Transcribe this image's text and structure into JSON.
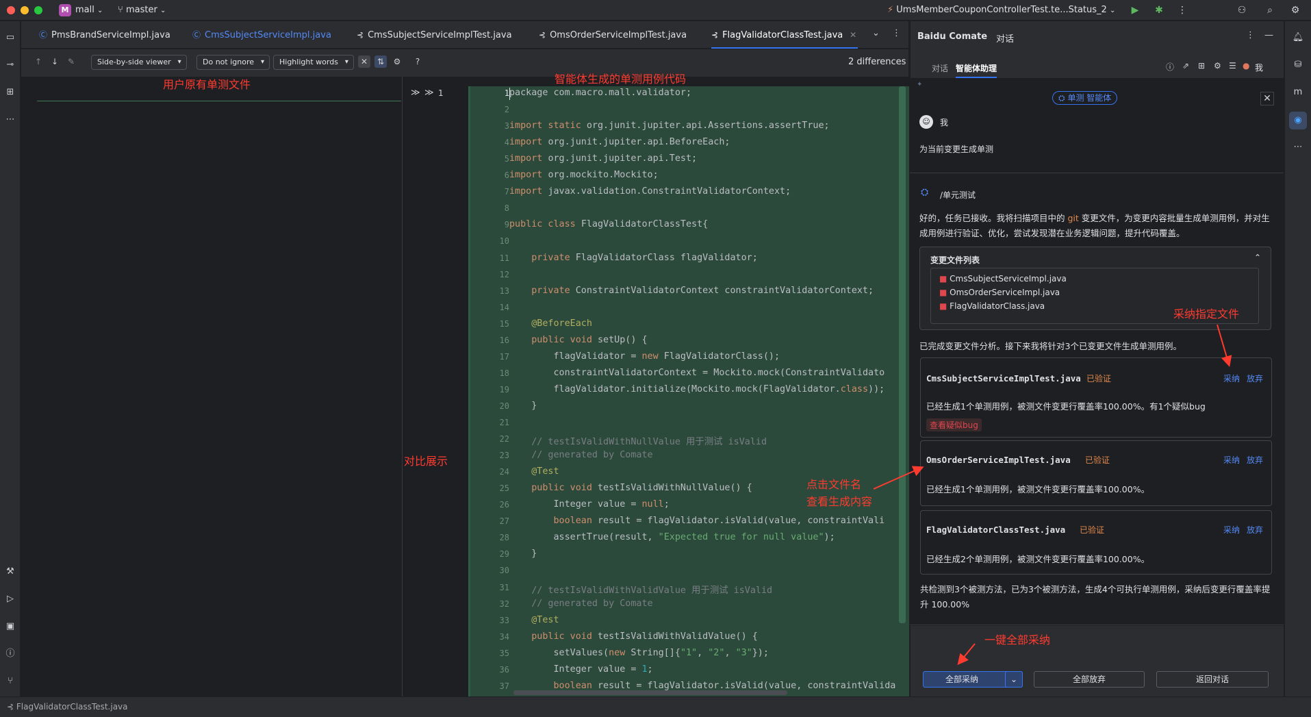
{
  "titlebar": {
    "project_badge": "M",
    "project_name": "mall",
    "branch": "master",
    "run_config": "UmsMemberCouponControllerTest.te...Status_2"
  },
  "tabs": [
    {
      "label": "PmsBrandServiceImpl.java"
    },
    {
      "label": "CmsSubjectServiceImpl.java"
    },
    {
      "label": "CmsSubjectServiceImplTest.java"
    },
    {
      "label": "OmsOrderServiceImplTest.java"
    },
    {
      "label": "FlagValidatorClassTest.java"
    }
  ],
  "diff_toolbar": {
    "viewer": "Side-by-side viewer",
    "ignore": "Do not ignore",
    "highlight": "Highlight words",
    "help": "?",
    "differences": "2 differences"
  },
  "gutter": {
    "line_counter": "1"
  },
  "annotations": {
    "left_pane": "用户原有单测文件",
    "code_pane": "智能体生成的单测用例代码",
    "compare": "对比展示",
    "click_file_1": "点击文件名",
    "click_file_2": "查看生成内容",
    "adopt_file": "采纳指定文件",
    "adopt_all": "一键全部采纳"
  },
  "code_lines": [
    {
      "n": "1"
    },
    {
      "n": "2"
    },
    {
      "n": "3"
    },
    {
      "n": "4"
    },
    {
      "n": "5"
    },
    {
      "n": "6"
    },
    {
      "n": "7"
    },
    {
      "n": "8"
    },
    {
      "n": "9"
    },
    {
      "n": "10"
    },
    {
      "n": "11"
    },
    {
      "n": "12"
    },
    {
      "n": "13"
    },
    {
      "n": "14"
    },
    {
      "n": "15"
    },
    {
      "n": "16"
    },
    {
      "n": "17"
    },
    {
      "n": "18"
    },
    {
      "n": "19"
    },
    {
      "n": "20"
    },
    {
      "n": "21"
    },
    {
      "n": "22"
    },
    {
      "n": "23"
    },
    {
      "n": "24"
    },
    {
      "n": "25"
    },
    {
      "n": "26"
    },
    {
      "n": "27"
    },
    {
      "n": "28"
    },
    {
      "n": "29"
    },
    {
      "n": "30"
    },
    {
      "n": "31"
    },
    {
      "n": "32"
    },
    {
      "n": "33"
    },
    {
      "n": "34"
    },
    {
      "n": "35"
    },
    {
      "n": "36"
    },
    {
      "n": "37"
    }
  ],
  "code_text": {
    "l1": "package com.macro.mall.validator;",
    "l3a": "import static ",
    "l3b": "org.junit.jupiter.api.Assertions.assertTrue;",
    "l4a": "import ",
    "l4b": "org.junit.jupiter.api.BeforeEach;",
    "l5a": "import ",
    "l5b": "org.junit.jupiter.api.Test;",
    "l6a": "import ",
    "l6b": "org.mockito.Mockito;",
    "l7a": "import ",
    "l7b": "javax.validation.ConstraintValidatorContext;",
    "l9a": "public class ",
    "l9b": "FlagValidatorClassTest{",
    "l11a": "    private ",
    "l11b": "FlagValidatorClass flagValidator;",
    "l13a": "    private ",
    "l13b": "ConstraintValidatorContext constraintValidatorContext;",
    "l15": "    @BeforeEach",
    "l16a": "    public void ",
    "l16b": "setUp() {",
    "l17a": "        flagValidator = ",
    "l17b": "new ",
    "l17c": "FlagValidatorClass();",
    "l18": "        constraintValidatorContext = Mockito.mock(ConstraintValidato",
    "l19a": "        flagValidator.initialize(Mockito.mock(FlagValidator.",
    "l19b": "class",
    "l19c": "));",
    "l20": "    }",
    "l22": "    // testIsValidWithNullValue 用于测试 isValid",
    "l23": "    // generated by Comate",
    "l24": "    @Test",
    "l25a": "    public void ",
    "l25b": "testIsValidWithNullValue() {",
    "l26a": "        Integer value = ",
    "l26b": "null",
    "l26c": ";",
    "l27a": "        boolean ",
    "l27b": "result = flagValidator.isValid(value, constraintVali",
    "l28a": "        assertTrue(result, ",
    "l28b": "\"Expected true for null value\"",
    "l28c": ");",
    "l29": "    }",
    "l31": "    // testIsValidWithValidValue 用于测试 isValid",
    "l32": "    // generated by Comate",
    "l33": "    @Test",
    "l34a": "    public void ",
    "l34b": "testIsValidWithValidValue() {",
    "l35a": "        setValues(",
    "l35b": "new ",
    "l35c": "String[]{",
    "l35d": "\"1\"",
    "l35e": ", ",
    "l35f": "\"2\"",
    "l35g": ", ",
    "l35h": "\"3\"",
    "l35i": "});",
    "l36a": "        Integer value = ",
    "l36b": "1",
    "l36c": ";",
    "l37a": "        boolean ",
    "l37b": "result = flagValidator.isValid(value, constraintValida"
  },
  "panel": {
    "title": "Baidu Comate",
    "title_tab": "对话",
    "subtab_chat": "对话",
    "subtab_agent": "智能体助理",
    "user_short": "我",
    "agent_chip": "单测 智能体",
    "user_name": "我",
    "user_message": "为当前变更生成单测",
    "command": "/单元测试",
    "reply_pre": "好的，任务已接收。我将扫描项目中的 ",
    "reply_git": "git",
    "reply_post": " 变更文件，为变更内容批量生成单测用例，并对生成用例进行验证、优化，尝试发现潜在业务逻辑问题，提升代码覆盖。",
    "changed_files_title": "变更文件列表",
    "changed_files": [
      "CmsSubjectServiceImpl.java",
      "OmsOrderServiceImpl.java",
      "FlagValidatorClass.java"
    ],
    "analysis_done": "已完成变更文件分析。接下来我将针对3个已变更文件生成单测用例。",
    "results": [
      {
        "file": "CmsSubjectServiceImplTest.java",
        "badge": "已验证",
        "adopt": "采纳",
        "discard": "放弃",
        "desc": "已经生成1个单测用例，被测文件变更行覆盖率100.00%。有1个疑似bug",
        "bug_link": "查看疑似bug"
      },
      {
        "file": "OmsOrderServiceImplTest.java",
        "badge": "已验证",
        "adopt": "采纳",
        "discard": "放弃",
        "desc": "已经生成1个单测用例，被测文件变更行覆盖率100.00%。"
      },
      {
        "file": "FlagValidatorClassTest.java",
        "badge": "已验证",
        "adopt": "采纳",
        "discard": "放弃",
        "desc": "已经生成2个单测用例，被测文件变更行覆盖率100.00%。"
      }
    ],
    "summary": "共检测到3个被测方法，已为3个被测方法，生成4个可执行单测用例，采纳后变更行覆盖率提升 100.00%",
    "btn_adopt_all": "全部采纳",
    "btn_discard_all": "全部放弃",
    "btn_back": "返回对话"
  },
  "status": {
    "file": "FlagValidatorClassTest.java"
  },
  "colors": {
    "accent": "#3574f0",
    "added_bg": "#2b4a3b",
    "annotation_red": "#ff3b30",
    "verified": "#e0884d"
  }
}
